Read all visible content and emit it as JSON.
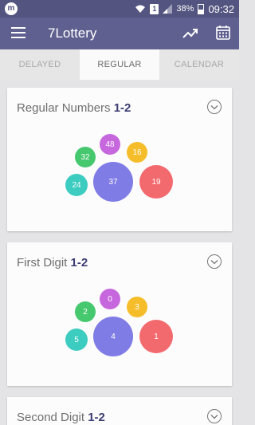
{
  "status_bar": {
    "app_badge": "m",
    "sim_badge": "1",
    "battery": "38%",
    "time": "09:32"
  },
  "app_bar": {
    "title": "7Lottery",
    "icons": [
      "menu-icon",
      "trending-up-icon",
      "calendar-icon"
    ]
  },
  "tabs": [
    {
      "label": "DELAYED",
      "active": false
    },
    {
      "label": "REGULAR",
      "active": true
    },
    {
      "label": "CALENDAR",
      "active": false
    }
  ],
  "colors": {
    "app_bar": "#5f6090",
    "status_bar": "#53547f",
    "accent": "#3c3d72"
  },
  "cards": [
    {
      "title": "Regular Numbers ",
      "range": "1-2",
      "balls": [
        {
          "label": "48",
          "color": "#c767dd"
        },
        {
          "label": "32",
          "color": "#46c86e"
        },
        {
          "label": "16",
          "color": "#f6bd2a"
        },
        {
          "label": "24",
          "color": "#3dccc0"
        },
        {
          "label": "37",
          "color": "#7f7ce6"
        },
        {
          "label": "19",
          "color": "#f36a6e"
        }
      ]
    },
    {
      "title": "First Digit ",
      "range": "1-2",
      "balls": [
        {
          "label": "0",
          "color": "#c767dd"
        },
        {
          "label": "2",
          "color": "#46c86e"
        },
        {
          "label": "3",
          "color": "#f6bd2a"
        },
        {
          "label": "5",
          "color": "#3dccc0"
        },
        {
          "label": "4",
          "color": "#7f7ce6"
        },
        {
          "label": "1",
          "color": "#f36a6e"
        }
      ]
    },
    {
      "title": "Second Digit ",
      "range": "1-2",
      "balls": []
    }
  ]
}
